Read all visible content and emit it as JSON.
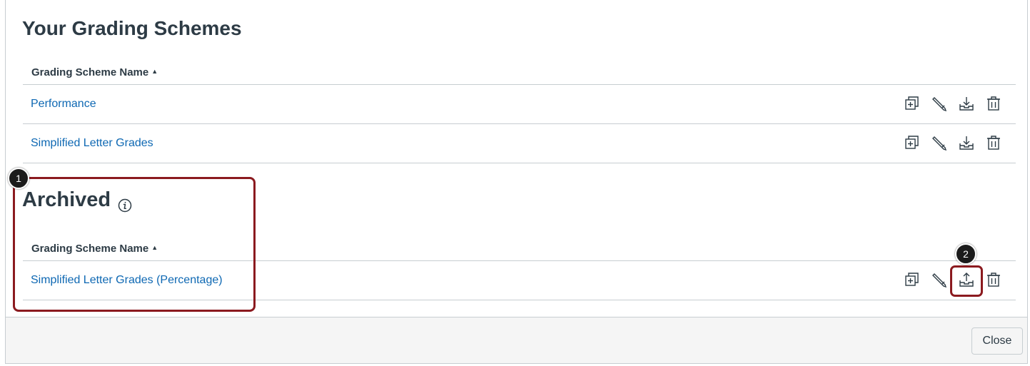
{
  "main_section": {
    "title": "Your Grading Schemes",
    "column_header": "Grading Scheme Name",
    "sort_indicator": "▲",
    "rows": [
      {
        "name": "Performance"
      },
      {
        "name": "Simplified Letter Grades"
      }
    ]
  },
  "archived_section": {
    "title": "Archived",
    "info_icon": "info-icon",
    "column_header": "Grading Scheme Name",
    "sort_indicator": "▲",
    "rows": [
      {
        "name": "Simplified Letter Grades (Percentage)"
      }
    ]
  },
  "row_actions": {
    "active": [
      "duplicate-icon",
      "edit-pencil-icon",
      "archive-icon",
      "trash-icon"
    ],
    "archived": [
      "duplicate-icon",
      "edit-pencil-icon",
      "unarchive-icon",
      "trash-icon"
    ]
  },
  "footer": {
    "close_label": "Close"
  },
  "callouts": {
    "badge_1": "1",
    "badge_2": "2"
  },
  "colors": {
    "text": "#2d3b45",
    "link": "#0e68b3",
    "callout_border": "#8b1a1f",
    "footer_bg": "#f5f5f5",
    "divider": "#c7cdd1"
  }
}
